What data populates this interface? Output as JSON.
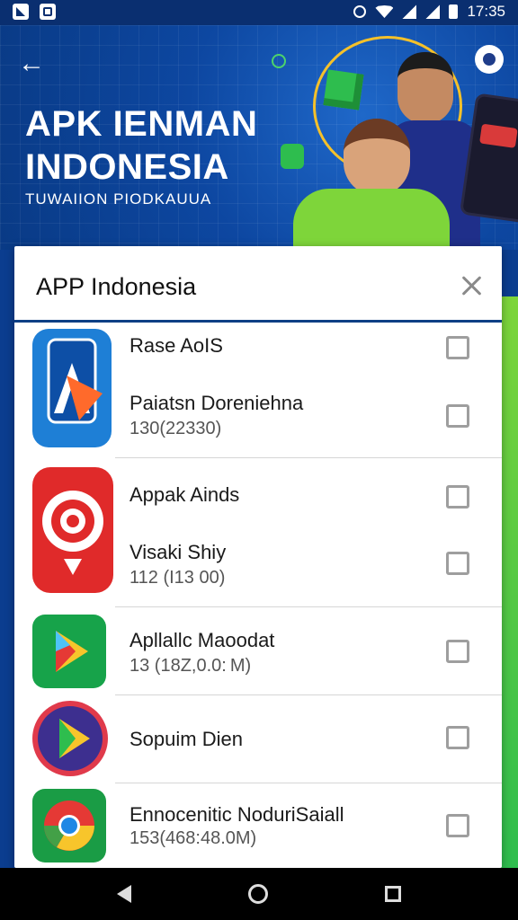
{
  "status_bar": {
    "time": "17:35"
  },
  "banner": {
    "title_line1": "APK IENMAN",
    "title_line2": "INDONESIA",
    "subtitle": "TUWAIION PIODKAUUA"
  },
  "dialog": {
    "title": "APP Indonesia",
    "rows": [
      {
        "icon": "blue-a-app-icon",
        "line1": "Rase AoIS",
        "line2": "Paiatsn Doreniehna",
        "line3": "130(22330)",
        "checked_1": false,
        "checked_2": false
      },
      {
        "icon": "red-target-app-icon",
        "line1": "Appak Ainds",
        "line2": "Visaki Shiy",
        "line3": "112 (I13 00)",
        "checked_1": false,
        "checked_2": false
      },
      {
        "icon": "play-store-icon",
        "line1": "Apllallc Maoodat",
        "line2": "13 (18Z,0.0: M)",
        "checked_1": false
      },
      {
        "icon": "play-circle-icon",
        "line1": "Sopuim Dien",
        "checked_1": false
      },
      {
        "icon": "chrome-icon",
        "line1": "Ennocenitic NoduriSaiall",
        "line2": "153(468:48.0M)",
        "checked_1": false
      }
    ]
  },
  "colors": {
    "banner": "#0d47a1",
    "header_rule": "#0d3f85",
    "accent_green": "#2ebd4e"
  }
}
